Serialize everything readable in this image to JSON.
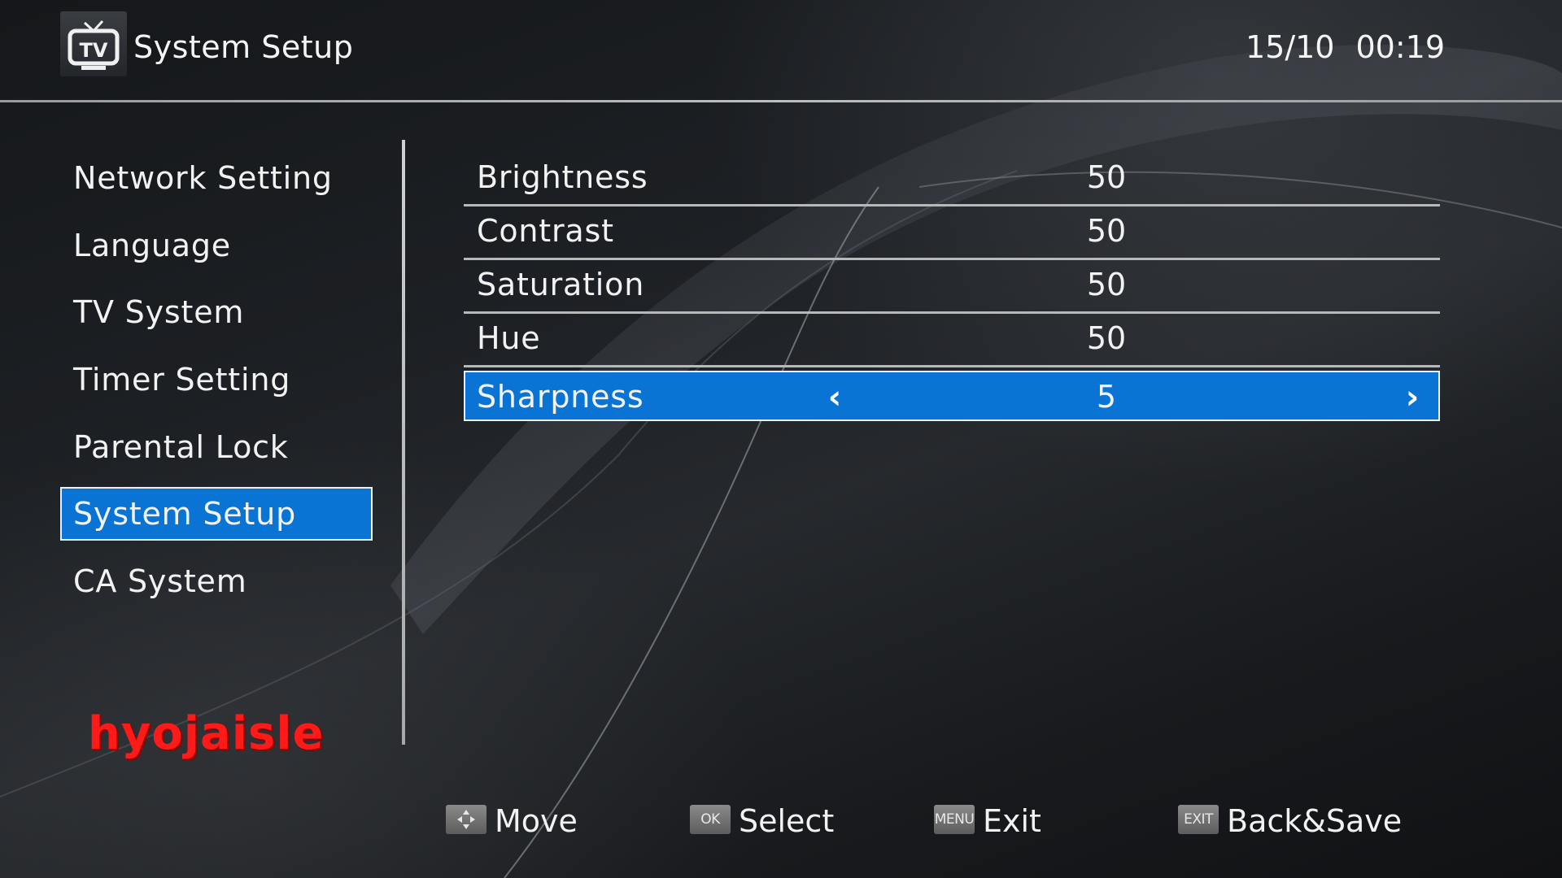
{
  "header": {
    "title": "System Setup",
    "date": "15/10",
    "time": "00:19",
    "icon": "tv-icon",
    "icon_label": "TV"
  },
  "sidebar": {
    "items": [
      {
        "label": "Network Setting"
      },
      {
        "label": "Language"
      },
      {
        "label": "TV System"
      },
      {
        "label": "Timer Setting"
      },
      {
        "label": "Parental Lock"
      },
      {
        "label": "System Setup",
        "selected": true
      },
      {
        "label": "CA System"
      }
    ]
  },
  "settings": {
    "rows": [
      {
        "label": "Brightness",
        "value": "50"
      },
      {
        "label": "Contrast",
        "value": "50"
      },
      {
        "label": "Saturation",
        "value": "50"
      },
      {
        "label": "Hue",
        "value": "50"
      },
      {
        "label": "Sharpness",
        "value": "5",
        "selected": true
      }
    ],
    "left_arrow_glyph": "‹",
    "right_arrow_glyph": "›"
  },
  "footer": {
    "hints": [
      {
        "key": "",
        "key_icon": "dpad-arrows-icon",
        "label": "Move"
      },
      {
        "key": "OK",
        "label": "Select"
      },
      {
        "key": "MENU",
        "label": "Exit"
      },
      {
        "key": "EXIT",
        "label": "Back&Save"
      }
    ]
  },
  "watermark": "hyojaisle",
  "colors": {
    "highlight": "#0a74d4",
    "highlight_border": "#e8f0ff",
    "watermark": "#ff1a1a",
    "divider": "#b8b8b8"
  }
}
